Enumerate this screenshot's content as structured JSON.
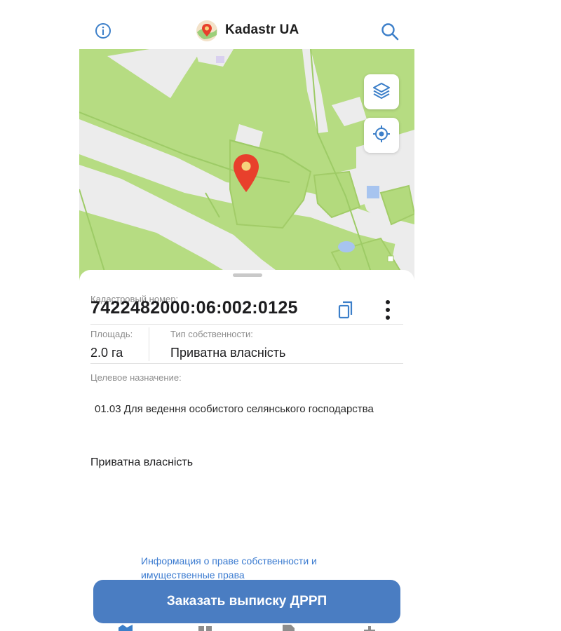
{
  "header": {
    "app_title": "Kadastr UA",
    "info_icon": "info-icon",
    "search_icon": "search-icon",
    "logo_icon": "map-pin-logo-icon"
  },
  "map": {
    "layers_icon": "layers-icon",
    "locate_icon": "crosshair-icon",
    "marker_icon": "map-marker-icon",
    "colors": {
      "parcel": "#b6dc82",
      "road": "#ececec",
      "parcel_edge": "#a8d070",
      "marker": "#e8402c",
      "building": "#a7c4ef"
    }
  },
  "parcel": {
    "cadastral_label": "Кадастровый номер:",
    "cadastral_number": "7422482000:06:002:0125",
    "area_label": "Площадь:",
    "area_value": "2.0 га",
    "ownership_type_label": "Тип собственности:",
    "ownership_type_value": "Приватна власність",
    "purpose_label": "Целевое назначение:",
    "purpose_value": "01.03 Для ведення особистого селянського господарства",
    "owner_value": "Приватна власність",
    "rights_link": "Информация о праве собственности и имущественные права",
    "order_button": "Заказать выписку ДРРП"
  },
  "accent_color": "#4a7dc2"
}
